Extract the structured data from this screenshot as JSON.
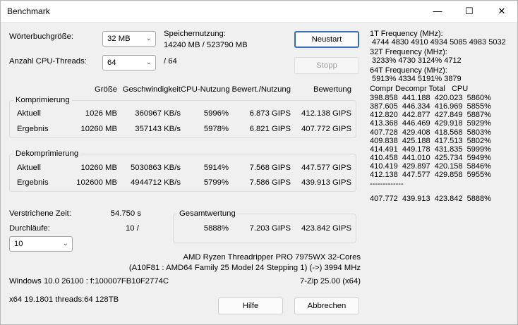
{
  "window": {
    "title": "Benchmark",
    "min": "—",
    "max": "☐",
    "close": "✕"
  },
  "settings": {
    "dict_label": "Wörterbuchgröße:",
    "dict_value": "32 MB",
    "threads_label": "Anzahl CPU-Threads:",
    "threads_value": "64",
    "threads_total": "/ 64",
    "mem_label": "Speichernutzung:",
    "mem_value": "14240 MB / 523790 MB"
  },
  "buttons": {
    "restart": "Neustart",
    "stop": "Stopp",
    "help": "Hilfe",
    "cancel": "Abbrechen"
  },
  "columns": [
    "Größe",
    "Geschwindigkeit",
    "CPU-Nutzung",
    "Bewert./Nutzung",
    "Bewertung"
  ],
  "compression": {
    "title": "Komprimierung",
    "rows": [
      {
        "label": "Aktuell",
        "size": "1026 MB",
        "speed": "360967 KB/s",
        "cpu": "5996%",
        "rpu": "6.873 GIPS",
        "rating": "412.138 GIPS"
      },
      {
        "label": "Ergebnis",
        "size": "10260 MB",
        "speed": "357143 KB/s",
        "cpu": "5978%",
        "rpu": "6.821 GIPS",
        "rating": "407.772 GIPS"
      }
    ]
  },
  "decompression": {
    "title": "Dekomprimierung",
    "rows": [
      {
        "label": "Aktuell",
        "size": "10260 MB",
        "speed": "5030863 KB/s",
        "cpu": "5914%",
        "rpu": "7.568 GIPS",
        "rating": "447.577 GIPS"
      },
      {
        "label": "Ergebnis",
        "size": "102600 MB",
        "speed": "4944712 KB/s",
        "cpu": "5799%",
        "rpu": "7.586 GIPS",
        "rating": "439.913 GIPS"
      }
    ]
  },
  "elapsed": {
    "label": "Verstrichene Zeit:",
    "value": "54.750 s"
  },
  "passes": {
    "label": "Durchläufe:",
    "value": "10 /",
    "combo": "10"
  },
  "total": {
    "title": "Gesamtwertung",
    "cpu": "5888%",
    "rpu": "7.203 GIPS",
    "rating": "423.842 GIPS"
  },
  "cpu": {
    "line1": "AMD Ryzen Threadripper PRO 7975WX 32-Cores",
    "line2": "(A10F81 : AMD64 Family 25 Model 24 Stepping 1) (->) 3994 MHz"
  },
  "os": "Windows 10.0 26100 : f:100007FB10F2774C",
  "version": "7-Zip 25.00 (x64)",
  "build": "x64 19.1801 threads:64 128TB",
  "right_panel": [
    "1T Frequency (MHz):",
    " 4744 4830 4910 4934 5085 4983 5032",
    "32T Frequency (MHz):",
    " 3233% 4730 3124% 4712",
    "64T Frequency (MHz):",
    " 5913% 4334 5191% 3879",
    "Compr Decompr Total   CPU",
    "398.858  441.188  420.023  5860%",
    "387.605  446.334  416.969  5855%",
    "412.820  442.877  427.849  5887%",
    "413.368  446.469  429.918  5929%",
    "407.728  429.408  418.568  5803%",
    "409.838  425.188  417.513  5802%",
    "414.491  449.178  431.835  5999%",
    "410.458  441.010  425.734  5949%",
    "410.419  429.897  420.158  5846%",
    "412.138  447.577  429.858  5955%",
    "-------------",
    "407.772  439.913  423.842  5888%"
  ]
}
